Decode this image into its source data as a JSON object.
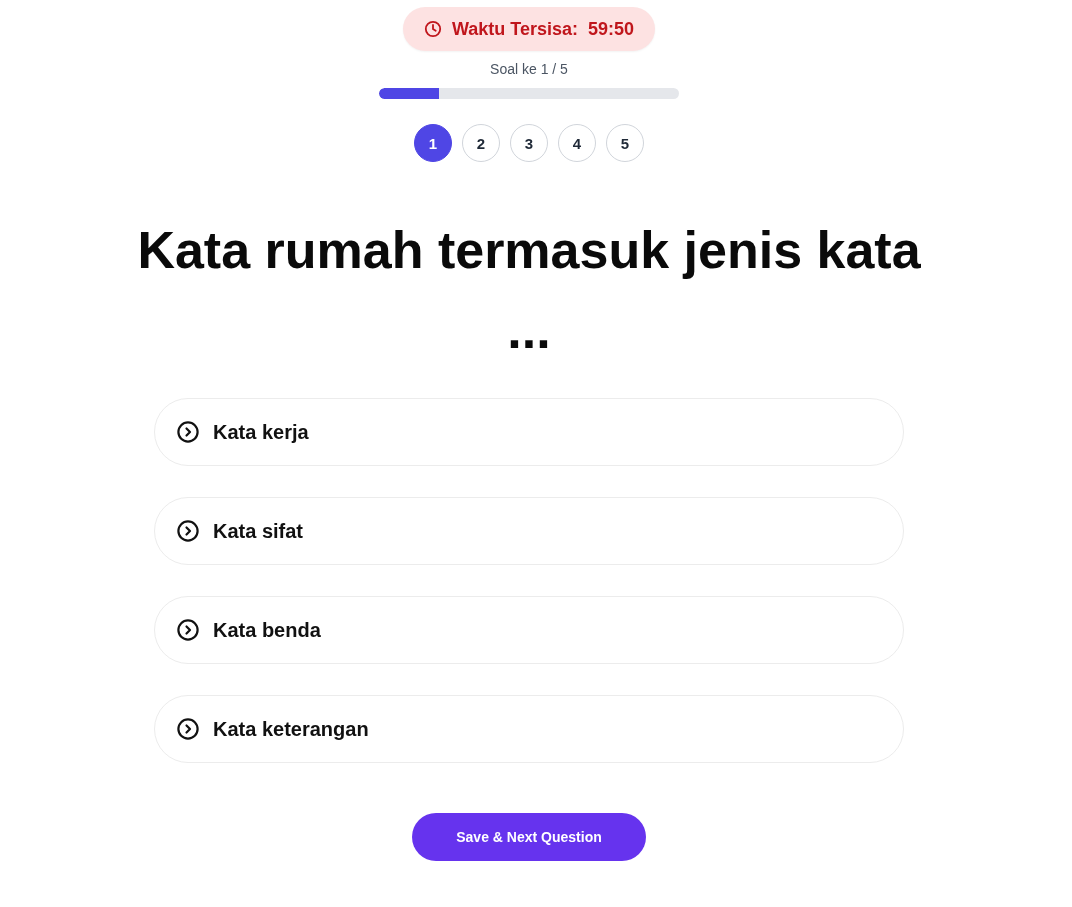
{
  "timer": {
    "label": "Waktu Tersisa:",
    "value": "59:50"
  },
  "progress": {
    "caption": "Soal ke 1 / 5",
    "level": 0.2
  },
  "question_numbers": [
    {
      "label": "1",
      "selected": true
    },
    {
      "label": "2",
      "selected": false
    },
    {
      "label": "3",
      "selected": false
    },
    {
      "label": "4",
      "selected": false
    },
    {
      "label": "5",
      "selected": false
    }
  ],
  "question": {
    "text": "Kata rumah termasuk jenis kata ..."
  },
  "options": [
    {
      "label": "Kata kerja",
      "selected": false
    },
    {
      "label": "Kata sifat",
      "selected": false
    },
    {
      "label": "Kata benda",
      "selected": false
    },
    {
      "label": "Kata keterangan",
      "selected": false
    }
  ],
  "submit_button": {
    "label": "Save & Next Question"
  }
}
